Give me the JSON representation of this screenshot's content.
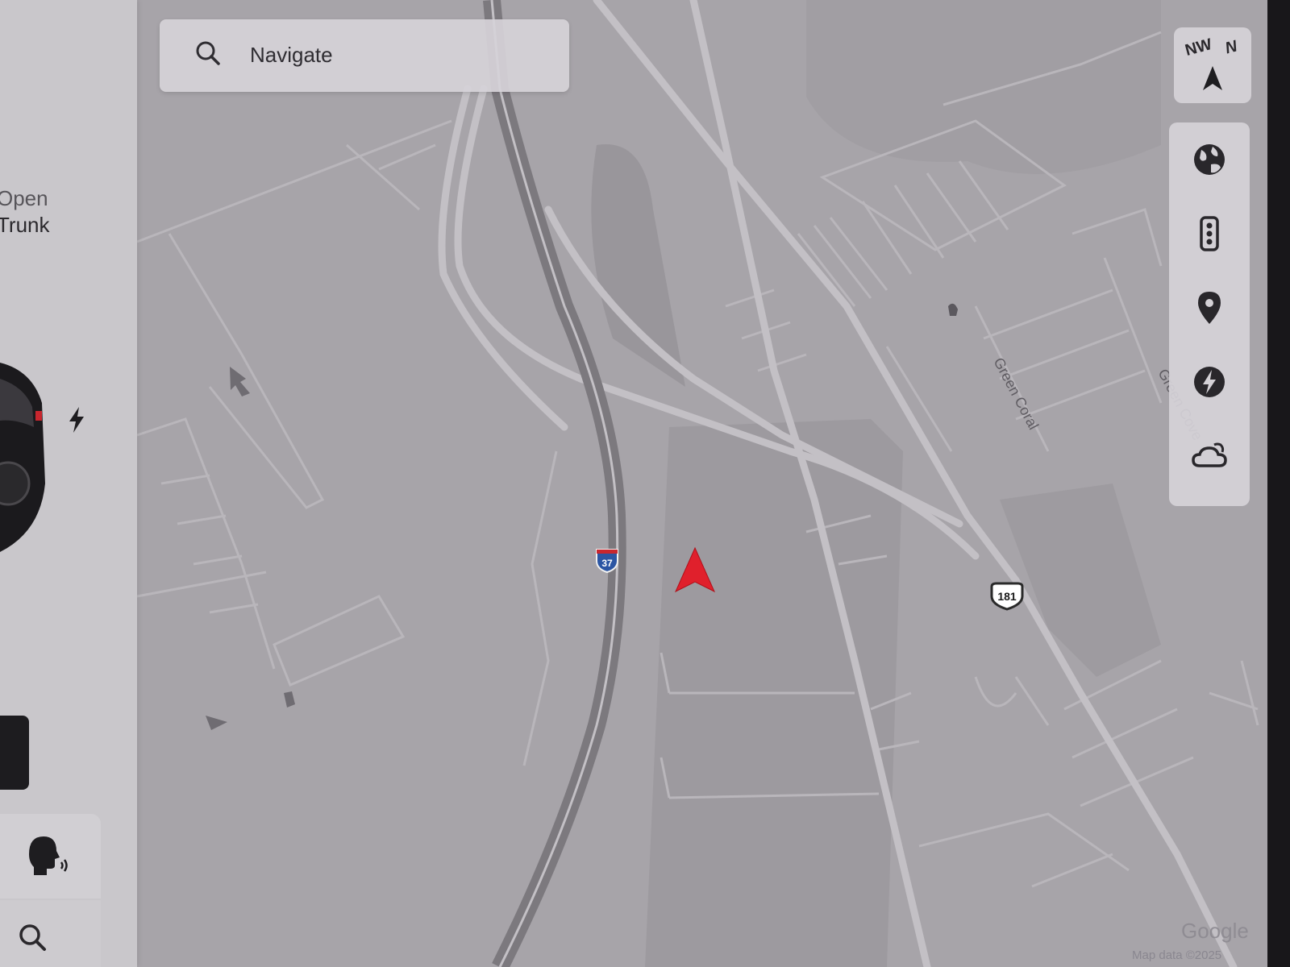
{
  "search": {
    "placeholder": "Navigate",
    "icon": "search-icon"
  },
  "compass": {
    "heading_label_1": "NW",
    "heading_label_2": "N"
  },
  "car_panel": {
    "trunk_label_line1": "Open",
    "trunk_label_line2": "Trunk",
    "charge_icon": "lightning-icon"
  },
  "tools": [
    {
      "name": "satellite-globe-icon"
    },
    {
      "name": "traffic-light-icon"
    },
    {
      "name": "location-pin-icon"
    },
    {
      "name": "supercharger-icon"
    },
    {
      "name": "weather-cloud-icon"
    }
  ],
  "map": {
    "road_labels": [
      "Green Coral",
      "Green Cove"
    ],
    "shields": [
      "37",
      "181"
    ],
    "attribution_logo": "Google",
    "attribution_text": "Map data ©2025"
  },
  "colors": {
    "vehicle_marker": "#e0202c",
    "interstate_shield": "#2b55a3"
  }
}
